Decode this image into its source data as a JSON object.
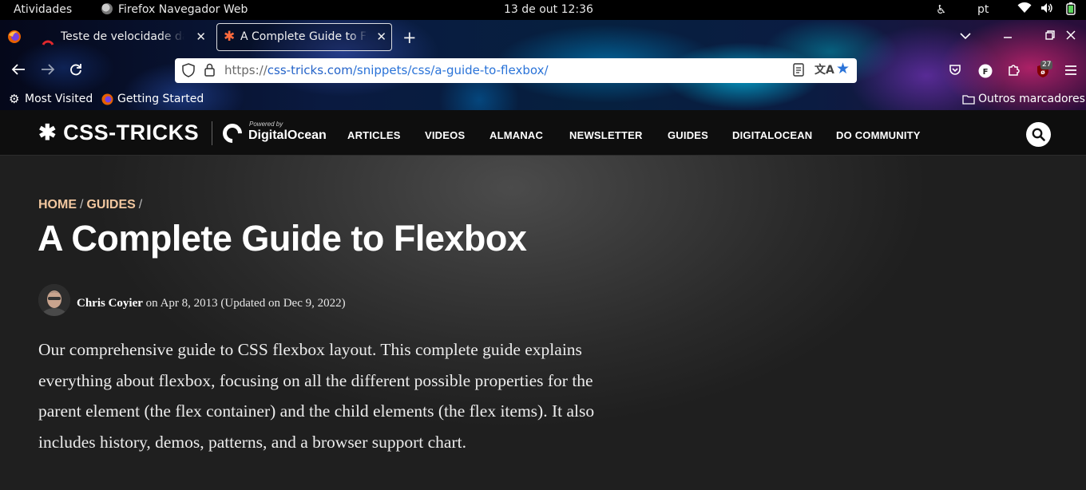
{
  "system_bar": {
    "activities": "Atividades",
    "app_name": "Firefox Navegador Web",
    "clock": "13 de out  12:36",
    "language": "pt"
  },
  "browser": {
    "tabs": [
      {
        "title": "Teste de velocidade da in"
      },
      {
        "title": "A Complete Guide to Flex",
        "active": true
      }
    ],
    "url": {
      "scheme": "https://",
      "host": "css-tricks.com",
      "path": "/snippets/css/a-guide-to-flexbox/"
    },
    "extension_badge": "27",
    "bookmarks": {
      "most_visited": "Most Visited",
      "getting_started": "Getting Started",
      "other": "Outros marcadores"
    }
  },
  "site": {
    "logo": "CSS-TRICKS",
    "sponsor_powered": "Powered by",
    "sponsor_name": "DigitalOcean",
    "nav": [
      "ARTICLES",
      "VIDEOS",
      "ALMANAC",
      "NEWSLETTER",
      "GUIDES",
      "DIGITALOCEAN",
      "DO COMMUNITY"
    ]
  },
  "article": {
    "breadcrumb": [
      "HOME",
      "GUIDES"
    ],
    "breadcrumb_sep": "/",
    "title": "A Complete Guide to Flexbox",
    "author": "Chris Coyier",
    "date_text": "on Apr 8, 2013 (Updated on Dec 9, 2022)",
    "intro": "Our comprehensive guide to CSS flexbox layout. This complete guide explains everything about flexbox, focusing on all the different possible properties for the parent element (the flex container) and the child elements (the flex items). It also includes history, demos, patterns, and a browser support chart."
  },
  "colors": {
    "breadcrumb": "#f2c79f",
    "bookmark_star": "#2a73d8",
    "url_host": "#2564c9"
  }
}
